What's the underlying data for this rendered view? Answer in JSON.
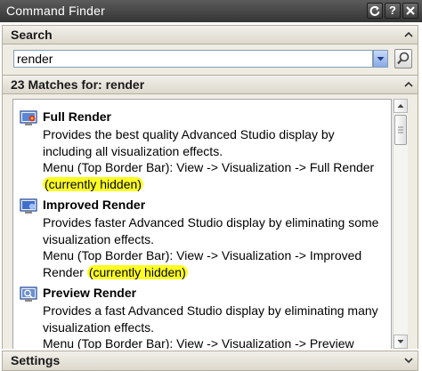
{
  "window": {
    "title": "Command Finder",
    "buttons": {
      "help": "?"
    }
  },
  "search_section": {
    "header": "Search",
    "input_value": "render"
  },
  "results_section": {
    "header": "23 Matches for: render",
    "items": [
      {
        "name": "Full Render",
        "icon": "full-render-icon",
        "desc_main": "Provides the best quality Advanced Studio display by including all visualization effects.",
        "desc_menu": "Menu (Top Border Bar): View -> Visualization -> Full Render",
        "hidden_note": "(currently hidden)"
      },
      {
        "name": "Improved Render",
        "icon": "improved-render-icon",
        "desc_main": "Provides faster Advanced Studio display by eliminating some visualization effects.",
        "desc_menu": "Menu (Top Border Bar): View -> Visualization -> Improved Render",
        "hidden_note": "(currently hidden)"
      },
      {
        "name": "Preview Render",
        "icon": "preview-render-icon",
        "desc_main": "Provides a fast Advanced Studio display by eliminating many visualization effects.",
        "desc_menu": "Menu (Top Border Bar): View -> Visualization -> Preview Render"
      }
    ]
  },
  "settings_section": {
    "header": "Settings"
  },
  "colors": {
    "highlight": "#ffff24",
    "titlebar": "#353535",
    "section_header": "#dcd8cc"
  }
}
